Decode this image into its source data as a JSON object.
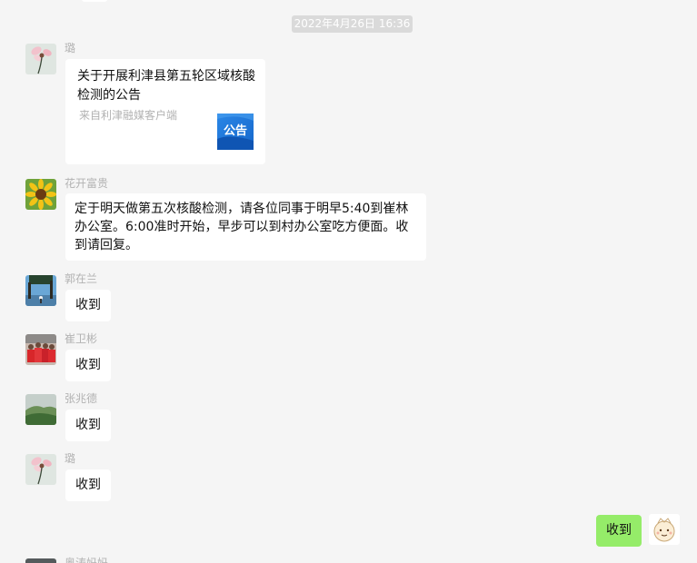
{
  "timestamp": "2022年4月26日 16:36",
  "messages": [
    {
      "sender": "璐",
      "avatar": "flower-avatar-icon",
      "type": "link-card",
      "card_title": "关于开展利津县第五轮区域核酸检测的公告",
      "card_source": "来自利津融媒客户端",
      "card_thumb_text": "公告"
    },
    {
      "sender": "花开富贵",
      "avatar": "sunflower-avatar-icon",
      "type": "text",
      "text": "定于明天做第五次核酸检测，请各位同事于明早5:40到崔林办公室。6:00准时开始，早步可以到村办公室吃方便面。收到请回复。"
    },
    {
      "sender": "郭在兰",
      "avatar": "tree-avatar-icon",
      "type": "text",
      "text": "收到"
    },
    {
      "sender": "崔卫彬",
      "avatar": "group-photo-avatar-icon",
      "type": "text",
      "text": "收到"
    },
    {
      "sender": "张兆德",
      "avatar": "landscape-avatar-icon",
      "type": "text",
      "text": "收到"
    },
    {
      "sender": "璐",
      "avatar": "flower-avatar-icon",
      "type": "text",
      "text": "收到"
    },
    {
      "sender": "",
      "avatar": "cartoon-avatar-icon",
      "type": "text",
      "self": true,
      "text": "收到"
    },
    {
      "sender": "奥涛妈妈",
      "avatar": "dark-avatar-icon",
      "type": "partial"
    }
  ],
  "colors": {
    "background": "#f5f5f5",
    "bubble_other": "#ffffff",
    "bubble_self": "#95ec69",
    "timestamp_bg": "#dadada",
    "sender_name": "#b2b2b2",
    "card_thumb": "#1a73d9"
  }
}
